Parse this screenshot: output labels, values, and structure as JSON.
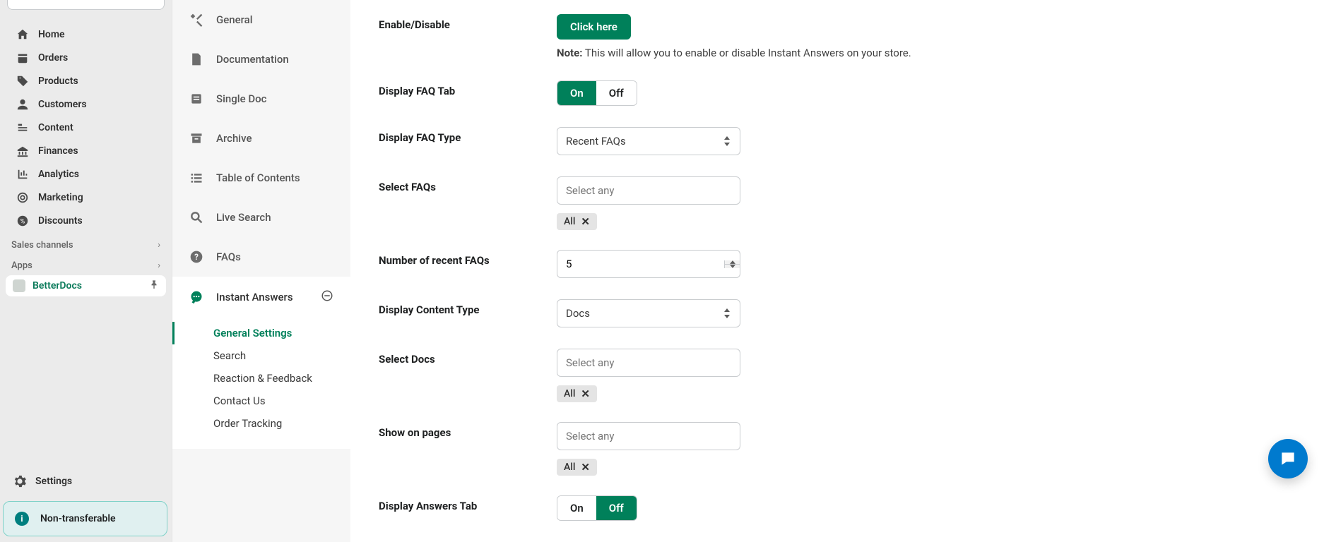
{
  "shopify_nav": {
    "items": [
      {
        "label": "Home"
      },
      {
        "label": "Orders"
      },
      {
        "label": "Products"
      },
      {
        "label": "Customers"
      },
      {
        "label": "Content"
      },
      {
        "label": "Finances"
      },
      {
        "label": "Analytics"
      },
      {
        "label": "Marketing"
      },
      {
        "label": "Discounts"
      }
    ],
    "sales_channels_label": "Sales channels",
    "apps_label": "Apps",
    "active_app": "BetterDocs",
    "settings_label": "Settings",
    "info_banner": "Non-transferable"
  },
  "app_nav": {
    "items": [
      {
        "label": "General"
      },
      {
        "label": "Documentation"
      },
      {
        "label": "Single Doc"
      },
      {
        "label": "Archive"
      },
      {
        "label": "Table of Contents"
      },
      {
        "label": "Live Search"
      },
      {
        "label": "FAQs"
      },
      {
        "label": "Instant Answers"
      }
    ],
    "sub_items": [
      {
        "label": "General Settings"
      },
      {
        "label": "Search"
      },
      {
        "label": "Reaction & Feedback"
      },
      {
        "label": "Contact Us"
      },
      {
        "label": "Order Tracking"
      }
    ]
  },
  "form": {
    "enable_label": "Enable/Disable",
    "enable_button": "Click here",
    "note_prefix": "Note:",
    "note_text": " This will allow you to enable or disable Instant Answers on your store.",
    "faq_tab_label": "Display FAQ Tab",
    "faq_type_label": "Display FAQ Type",
    "faq_type_value": "Recent FAQs",
    "select_faqs_label": "Select FAQs",
    "select_any_placeholder": "Select any",
    "chip_all": "All",
    "num_faqs_label": "Number of recent FAQs",
    "num_faqs_value": "5",
    "content_type_label": "Display Content Type",
    "content_type_value": "Docs",
    "select_docs_label": "Select Docs",
    "show_pages_label": "Show on pages",
    "answers_tab_label": "Display Answers Tab",
    "on": "On",
    "off": "Off"
  }
}
